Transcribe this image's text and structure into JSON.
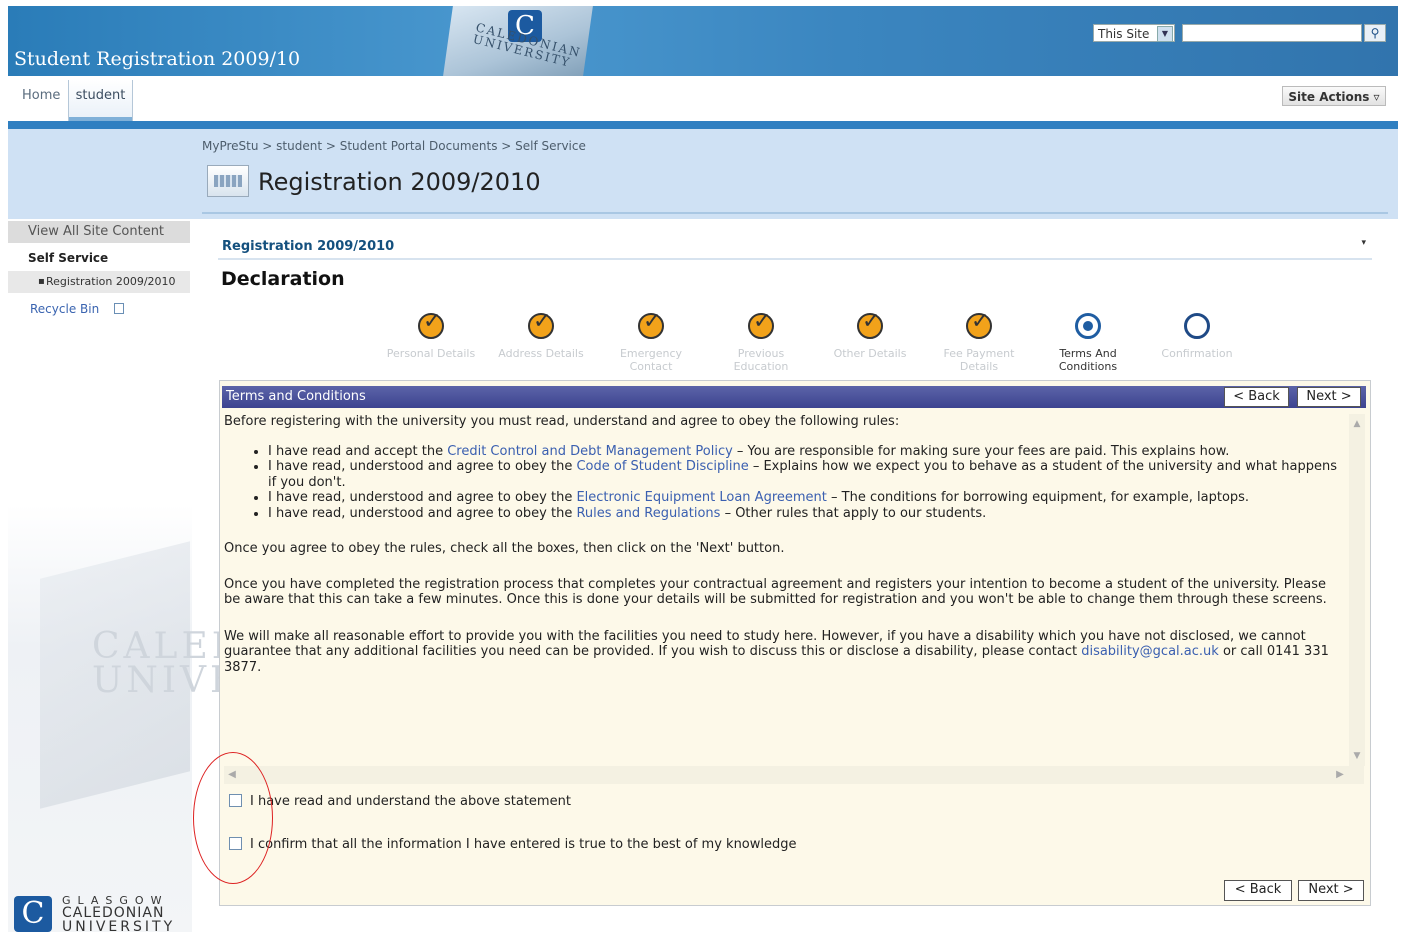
{
  "header": {
    "site_title": "Student Registration 2009/10",
    "logo_letter": "C",
    "logo_text": "GLASGOW CALEDONIAN UNIVERSITY",
    "search_scope": "This Site",
    "search_icon": "search-icon",
    "search_value": ""
  },
  "tabs": {
    "home": "Home",
    "student": "student"
  },
  "site_actions": "Site Actions ▿",
  "breadcrumb": "MyPreStu > student > Student Portal Documents > Self Service",
  "page_title": "Registration 2009/2010",
  "sidebar": {
    "view_all": "View All Site Content",
    "heading": "Self Service",
    "item": "Registration 2009/2010",
    "recycle": "Recycle Bin"
  },
  "webpart": {
    "title": "Registration 2009/2010",
    "menu": "▾"
  },
  "declaration": "Declaration",
  "steps": [
    {
      "label": "Personal Details",
      "state": "done"
    },
    {
      "label": "Address Details",
      "state": "done"
    },
    {
      "label": "Emergency Contact",
      "state": "done"
    },
    {
      "label": "Previous Education",
      "state": "done"
    },
    {
      "label": "Other Details",
      "state": "done"
    },
    {
      "label": "Fee Payment Details",
      "state": "done"
    },
    {
      "label": "Terms And Conditions",
      "state": "current"
    },
    {
      "label": "Confirmation",
      "state": "todo"
    }
  ],
  "panel": {
    "title": "Terms and Conditions",
    "back": "< Back",
    "next": "Next >",
    "intro": "Before registering with the university you must read, understand and agree to obey the following rules:",
    "rules": [
      {
        "pre": "I have read and accept the ",
        "link": "Credit Control and Debt Management Policy",
        "post": " – You are responsible for making sure your fees are paid.  This explains how."
      },
      {
        "pre": "I have read, understood and agree to obey the ",
        "link": "Code of Student Discipline",
        "post": " – Explains how we expect you to behave as a student of the university and what happens if you don't."
      },
      {
        "pre": "I have read, understood and agree to obey the ",
        "link": "Electronic Equipment Loan Agreement",
        "post": " – The conditions for borrowing equipment, for example, laptops."
      },
      {
        "pre": "I have read, understood and agree to obey the ",
        "link": "Rules and Regulations",
        "post": " – Other rules that apply to our students."
      }
    ],
    "para1": "Once you agree to obey the rules, check all the boxes, then click on the 'Next' button.",
    "para2": "Once you have completed the registration process that completes your contractual agreement and registers your intention to become a student of the university. Please be aware that this can take a few minutes. Once this is done your details will be submitted for registration and you won't be able to change them through these screens.",
    "para3_pre": "We will make all reasonable effort to provide you with the facilities you need to study here.  However, if you have a disability which you have not disclosed, we cannot guarantee that any additional facilities you need can be provided. If you wish to discuss this or disclose a disability, please contact ",
    "para3_link": "disability@gcal.ac.uk",
    "para3_post": " or call 0141 331 3877.",
    "check1": "I have read and understand the above statement",
    "check2": "I confirm that all the information I have entered is true to the best of my knowledge"
  },
  "footer_logo": {
    "letter": "C",
    "line1": "GLASGOW",
    "line2": "CALEDONIAN",
    "line3": "UNIVERSITY"
  },
  "colors": {
    "brand_blue": "#2f7fc1",
    "panel_bar": "#3c4390",
    "step_done": "#f2a21a",
    "annotation_circle": "#dd2222"
  }
}
